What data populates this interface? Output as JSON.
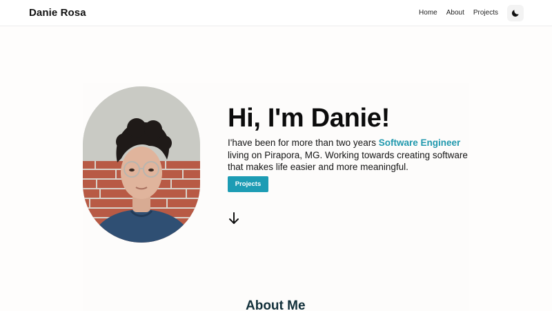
{
  "header": {
    "brand": "Danie Rosa",
    "nav": [
      "Home",
      "About",
      "Projects"
    ],
    "theme_icon": "moon-icon"
  },
  "hero": {
    "title": "Hi, I'm Danie!",
    "desc_before": "I'have been for more than two years ",
    "role": "Software Engineer",
    "desc_after": " living on Pirapora, MG. Working towards creating software that makes life easier and more meaningful.",
    "cta_label": "Projects",
    "scroll_icon": "arrow-down-icon"
  },
  "about": {
    "title": "About Me"
  },
  "colors": {
    "accent": "#1d9cb4",
    "role_text": "#1f98ad",
    "section_title": "#12303a"
  }
}
